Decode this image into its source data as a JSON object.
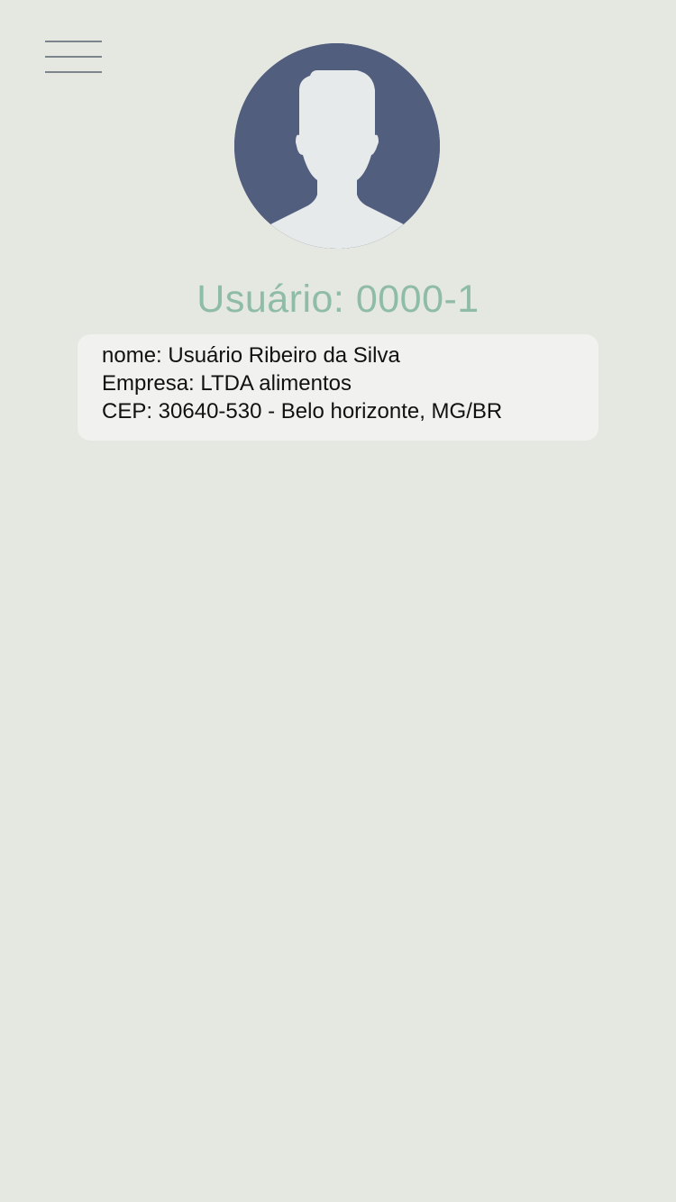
{
  "header": {
    "menu_icon": "hamburger-menu-icon"
  },
  "profile": {
    "avatar_icon": "default-user-avatar-icon",
    "user_id_label": "Usuário: 0000-1",
    "info": {
      "name_line": "nome: Usuário Ribeiro da Silva",
      "company_line": "Empresa: LTDA alimentos",
      "address_line": "CEP: 30640-530 - Belo horizonte, MG/BR"
    }
  },
  "colors": {
    "background": "#e5e7e1",
    "accent": "#8fbca6",
    "avatar_background": "#525e7d",
    "avatar_silhouette": "#e6eaeb",
    "card_background": "#f1f1ef"
  }
}
